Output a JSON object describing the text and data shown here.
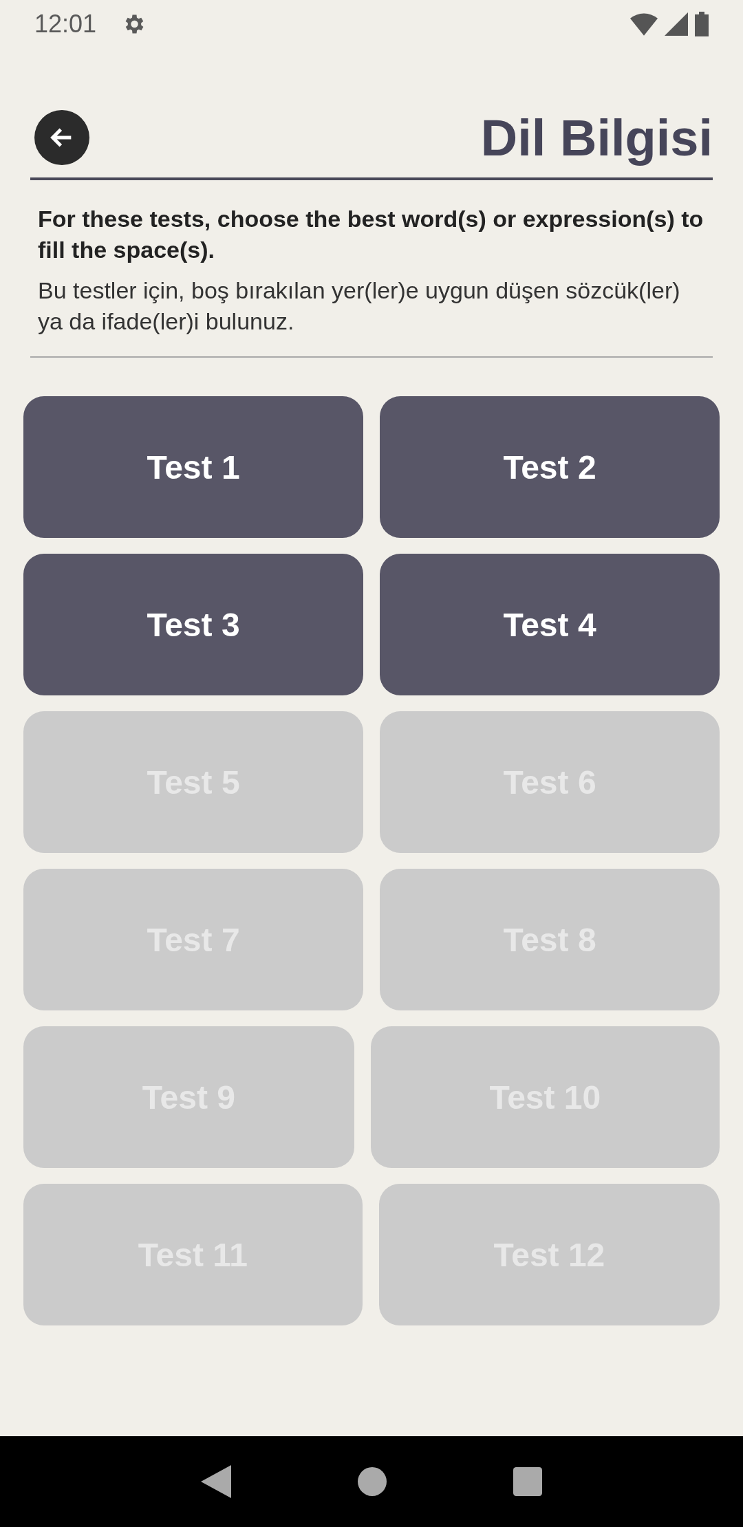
{
  "status_bar": {
    "time": "12:01"
  },
  "header": {
    "title": "Dil Bilgisi"
  },
  "instructions": {
    "english": "For these tests, choose the best word(s) or expression(s) to fill the space(s).",
    "turkish": "Bu testler için, boş bırakılan yer(ler)e uygun düşen sözcük(ler) ya da ifade(ler)i bulunuz."
  },
  "tests": [
    {
      "label": "Test 1",
      "disabled": false
    },
    {
      "label": "Test 2",
      "disabled": false
    },
    {
      "label": "Test 3",
      "disabled": false
    },
    {
      "label": "Test 4",
      "disabled": false
    },
    {
      "label": "Test 5",
      "disabled": true
    },
    {
      "label": "Test 6",
      "disabled": true
    },
    {
      "label": "Test 7",
      "disabled": true
    },
    {
      "label": "Test 8",
      "disabled": true
    },
    {
      "label": "Test 9",
      "disabled": true
    },
    {
      "label": "Test 10",
      "disabled": true
    },
    {
      "label": "Test 11",
      "disabled": true
    },
    {
      "label": "Test 12",
      "disabled": true
    }
  ]
}
